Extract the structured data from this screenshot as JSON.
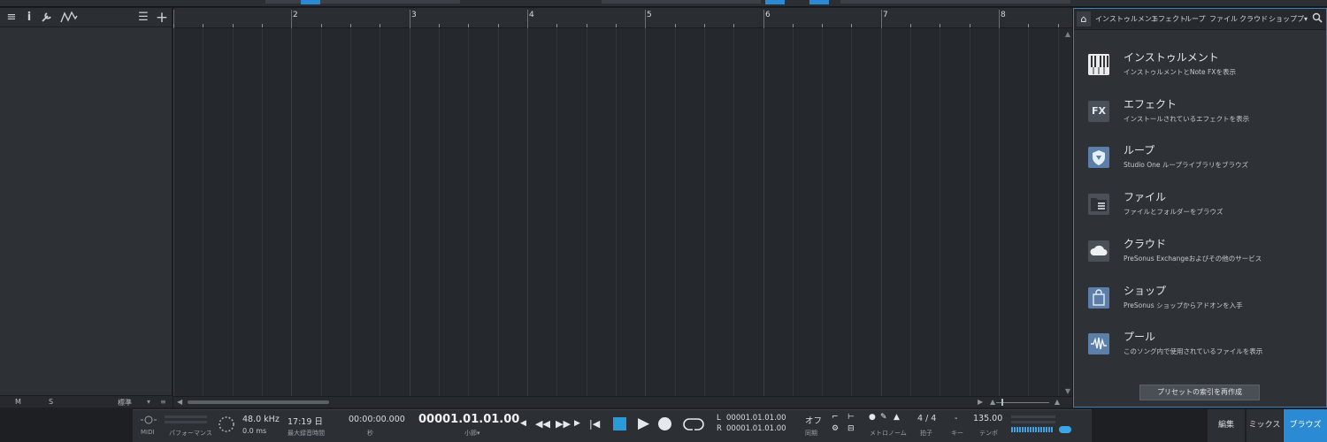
{
  "ruler": {
    "bars": [
      "2",
      "3",
      "4",
      "5",
      "6",
      "7",
      "8"
    ]
  },
  "track_footer": {
    "m": "M",
    "s": "S",
    "mode": "標準"
  },
  "browser": {
    "tabs": [
      "インストゥルメント",
      "エフェクト",
      "ループ",
      "ファイル",
      "クラウド",
      "ショップ",
      "プ▾"
    ],
    "items": [
      {
        "title": "インストゥルメント",
        "desc": "インストゥルメントとNote FXを表示",
        "icon": "piano-keys-icon"
      },
      {
        "title": "エフェクト",
        "desc": "インストールされているエフェクトを表示",
        "icon": "fx-icon"
      },
      {
        "title": "ループ",
        "desc": "Studio One ループライブラリをブラウズ",
        "icon": "loop-shield-icon"
      },
      {
        "title": "ファイル",
        "desc": "ファイルとフォルダーをブラウズ",
        "icon": "folder-list-icon"
      },
      {
        "title": "クラウド",
        "desc": "PreSonus Exchangeおよびその他のサービス",
        "icon": "cloud-icon"
      },
      {
        "title": "ショップ",
        "desc": "PreSonus ショップからアドオンを入手",
        "icon": "shop-bag-icon"
      },
      {
        "title": "プール",
        "desc": "このソング内で使用されているファイルを表示",
        "icon": "waveform-icon"
      }
    ],
    "rebuild_label": "プリセットの索引を再作成"
  },
  "transport": {
    "midi_label": "MIDI",
    "perf_label": "パフォーマンス",
    "sample_rate": "48.0 kHz",
    "latency": "0.0 ms",
    "record_time": "17:19 日",
    "record_time_label": "最大録音時間",
    "time": "00:00:00.000",
    "time_label": "秒",
    "position": "00001.01.01.00",
    "position_label": "小節▾",
    "loop_l_label": "L",
    "loop_l": "00001.01.01.00",
    "loop_r_label": "R",
    "loop_r": "00001.01.01.00",
    "sync": "オフ",
    "sync_label": "同期",
    "metronome_label": "メトロノーム",
    "signature": "4 / 4",
    "signature_label": "拍子",
    "key": "-",
    "key_label": "キー",
    "tempo": "135.00",
    "tempo_label": "テンポ"
  },
  "view_buttons": {
    "edit": "編集",
    "mix": "ミックス",
    "browse": "ブラウズ"
  },
  "colors": {
    "accent": "#2a8ad4",
    "panel": "#2e3136",
    "arrange": "#25282c"
  }
}
